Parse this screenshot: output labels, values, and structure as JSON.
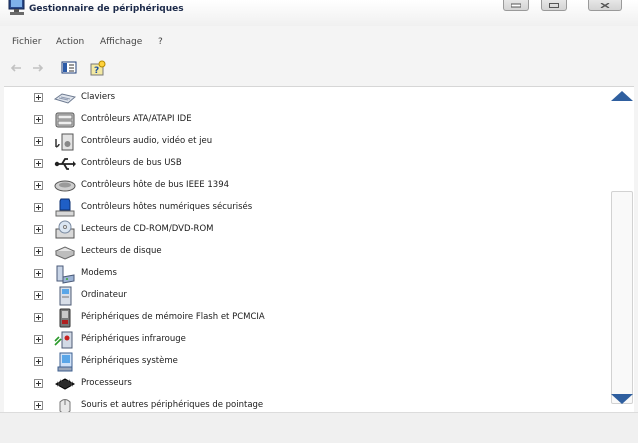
{
  "window": {
    "title": "Gestionnaire de périphériques",
    "controls": {
      "minimize_icon": "minimize-icon",
      "maximize_icon": "maximize-icon",
      "close_icon": "close-icon"
    }
  },
  "menu": {
    "items": [
      {
        "label": "Fichier"
      },
      {
        "label": "Action"
      },
      {
        "label": "Affichage"
      },
      {
        "label": "?"
      }
    ]
  },
  "toolbar": {
    "buttons": [
      {
        "icon": "back-arrow-icon",
        "enabled": false
      },
      {
        "icon": "forward-arrow-icon",
        "enabled": false
      },
      {
        "icon": "properties-icon",
        "enabled": true
      },
      {
        "icon": "help-icon",
        "enabled": true
      }
    ]
  },
  "tree": {
    "items": [
      {
        "label": "Claviers",
        "icon": "keyboard-icon"
      },
      {
        "label": "Contrôleurs ATA/ATAPI IDE",
        "icon": "ide-controller-icon"
      },
      {
        "label": "Contrôleurs audio, vidéo et jeu",
        "icon": "audio-icon"
      },
      {
        "label": "Contrôleurs de bus USB",
        "icon": "usb-icon"
      },
      {
        "label": "Contrôleurs hôte de bus IEEE 1394",
        "icon": "firewire-icon"
      },
      {
        "label": "Contrôleurs hôtes numériques sécurisés",
        "icon": "sd-host-icon"
      },
      {
        "label": "Lecteurs de CD-ROM/DVD-ROM",
        "icon": "cdrom-icon"
      },
      {
        "label": "Lecteurs de disque",
        "icon": "disk-drive-icon"
      },
      {
        "label": "Modems",
        "icon": "modem-icon"
      },
      {
        "label": "Ordinateur",
        "icon": "computer-icon"
      },
      {
        "label": "Périphériques de mémoire Flash et PCMCIA",
        "icon": "flash-memory-icon"
      },
      {
        "label": "Périphériques infrarouge",
        "icon": "infrared-icon"
      },
      {
        "label": "Périphériques système",
        "icon": "system-device-icon"
      },
      {
        "label": "Processeurs",
        "icon": "processor-icon"
      },
      {
        "label": "Souris et autres périphériques de pointage",
        "icon": "mouse-icon"
      }
    ]
  },
  "colors": {
    "title_text": "#1c2a4a",
    "scroll_arrow": "#2f5f9f",
    "tree_background": "#ffffff"
  }
}
